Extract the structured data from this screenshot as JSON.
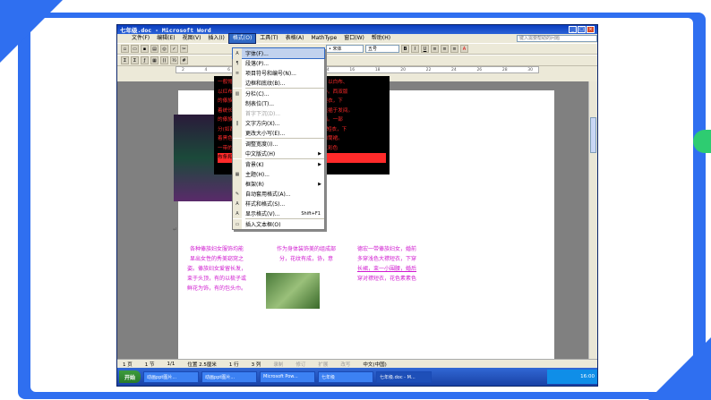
{
  "window": {
    "title": "七年级.doc - Microsoft Word",
    "controls": [
      "_",
      "□",
      "×"
    ]
  },
  "menubar": {
    "items": [
      "文件(F)",
      "编辑(E)",
      "视图(V)",
      "插入(I)",
      "格式(O)",
      "工具(T)",
      "表格(A)",
      "MathType",
      "窗口(W)",
      "帮助(H)"
    ],
    "help_placeholder": "键入需要帮助的问题"
  },
  "toolbar": {
    "font_box": "• 宋体",
    "size_box": "五号",
    "bold": "B",
    "italic": "I",
    "underline": "U"
  },
  "format_menu": {
    "items": [
      {
        "icon": "A",
        "label": "字体(F)...",
        "highlighted": true
      },
      {
        "icon": "¶",
        "label": "段落(P)..."
      },
      {
        "icon": "≡",
        "label": "项目符号和编号(N)..."
      },
      {
        "icon": "",
        "label": "边框和底纹(B)..."
      },
      {
        "sep": true
      },
      {
        "icon": "▥",
        "label": "分栏(C)..."
      },
      {
        "icon": "",
        "label": "制表位(T)..."
      },
      {
        "icon": "",
        "label": "首字下沉(D)...",
        "disabled": true
      },
      {
        "icon": "‖",
        "label": "文字方向(X)..."
      },
      {
        "icon": "",
        "label": "更改大小写(E)..."
      },
      {
        "sep": true
      },
      {
        "icon": "",
        "label": "调整宽度(I)..."
      },
      {
        "icon": "",
        "label": "中文版式(H)",
        "submenu": true
      },
      {
        "sep": true
      },
      {
        "icon": "",
        "label": "背景(K)",
        "submenu": true
      },
      {
        "icon": "▦",
        "label": "主题(H)..."
      },
      {
        "icon": "",
        "label": "框架(R)",
        "submenu": true
      },
      {
        "icon": "✎",
        "label": "自动套用格式(A)..."
      },
      {
        "icon": "A",
        "label": "样式和格式(S)..."
      },
      {
        "icon": "A",
        "label": "显示格式(V)...",
        "shortcut": "Shift+F1"
      },
      {
        "sep": true
      },
      {
        "icon": "▭",
        "label": "插入文本框(O)"
      }
    ]
  },
  "document": {
    "red_lines": [
      "一般常穿无领对襟或大襟小袖短衫，下着长管裤，以白布、",
      "以红布或蓝布包头，佩镶精美的服饰，因地区而异。西双版",
      "的傣族妇女上着各色紧身内衣，外罩紧无领窄袖短衣，下",
      "着统长至脚面的筒裙，长发挽髻，并用精美的银梳插于发间。",
      "的傣族妇女，一部分也穿大襟宽袖上衣，色彩艳丽。一部",
      "分(如西双版纳、德宏一带地)则穿白色或浅色大襟短衣，下",
      "着黑色长裙，束一株花围腰，婚后改穿对襟短衣和筒裙。",
      "一带的傣族妇女，上穿开襟短衣，着黑裙，裙上以彩色",
      "布条和银泡装饰，缀线装花图案，无彩鲜艳。"
    ],
    "col1": [
      "各种傣族妇女服饰均能",
      "显出女性的秀美窈窕之",
      "姿。傣族妇女爱留长发，",
      "束于头顶，有的以梳子或",
      "鲜花为饰，有的包头巾。"
    ],
    "col2": [
      "作为身体装饰美的组成部",
      "分，花纹有成，协，意"
    ],
    "col3": [
      "德宏一带傣族妇女，婚前",
      "多穿浅色大襟短衣，下穿",
      "长裙，束一小围腰，婚后",
      "穿对襟短衣，花色素素色"
    ],
    "para_mark": "↵"
  },
  "statusbar": {
    "page": "1 页",
    "section": "1 节",
    "page_of": "1/1",
    "position": "位置 2.5厘米",
    "line": "1 行",
    "column": "3 列",
    "rec": "录制",
    "rev": "修订",
    "ext": "扩展",
    "ovr": "改写",
    "lang": "中文(中国)"
  },
  "taskbar": {
    "start": "开始",
    "tasks": [
      "动画ppt图片...",
      "动画ppt图片...",
      "Microsoft Pow...",
      "七年级",
      "七年级.doc - M..."
    ],
    "active_index": 4,
    "clock": "16:00"
  },
  "colors": {
    "frame_blue": "#2f6ff0",
    "menu_highlight": "#c1d2ee",
    "red_text": "#ff2a2a",
    "magenta_text": "#d01ad0"
  }
}
